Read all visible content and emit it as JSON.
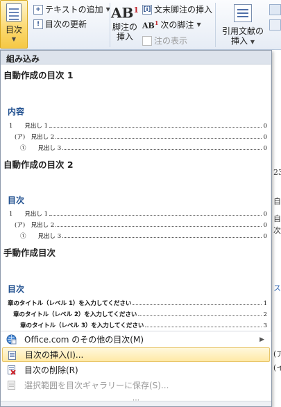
{
  "ribbon": {
    "toc_label": "目次",
    "add_text_label": "テキストの追加",
    "update_toc_label": "目次の更新",
    "insert_footnote_label_1": "脚注の",
    "insert_footnote_label_2": "挿入",
    "insert_endnote_label": "文末脚注の挿入",
    "next_footnote_label": "次の脚注",
    "show_notes_label": "注の表示",
    "insert_citation_label_1": "引用文献の",
    "insert_citation_label_2": "挿入",
    "ab_text": "AB",
    "ab_sup": "1",
    "endnote_icon_text": "[i]"
  },
  "doc_bg": [
    "23",
    "自",
    "自",
    "次",
    "ス",
    "(ア",
    "(イ"
  ],
  "menu": {
    "header": "組み込み",
    "auto1": {
      "title": "自動作成の目次 1",
      "heading": "内容",
      "lines": [
        {
          "label": "1　　見出し 1",
          "page": "0"
        },
        {
          "label": "(ア)　見出し 2",
          "page": "0"
        },
        {
          "label": "①　　見出し 3",
          "page": "0"
        }
      ]
    },
    "auto2": {
      "title": "自動作成の目次 2",
      "heading": "目次",
      "lines": [
        {
          "label": "1　　見出し 1",
          "page": "0"
        },
        {
          "label": "(ア)　見出し 2",
          "page": "0"
        },
        {
          "label": "①　　見出し 3",
          "page": "0"
        }
      ]
    },
    "manual": {
      "title": "手動作成目次",
      "heading": "目次",
      "lines": [
        {
          "label": "章のタイトル（レベル 1）を入力してください",
          "page": "1"
        },
        {
          "label": "章のタイトル（レベル 2）を入力してください",
          "page": "2"
        },
        {
          "label": "章のタイトル（レベル 3）を入力してください",
          "page": "3"
        }
      ]
    },
    "items": [
      {
        "label": "Office.com のその他の目次(M)"
      },
      {
        "label": "目次の挿入(I)..."
      },
      {
        "label": "目次の削除(R)"
      },
      {
        "label": "選択範囲を目次ギャラリーに保存(S)..."
      }
    ]
  },
  "colors": {
    "accent_heading": "#1f4f8f",
    "highlight": "#ffe9a6",
    "toc_button": "#fbd86d"
  }
}
